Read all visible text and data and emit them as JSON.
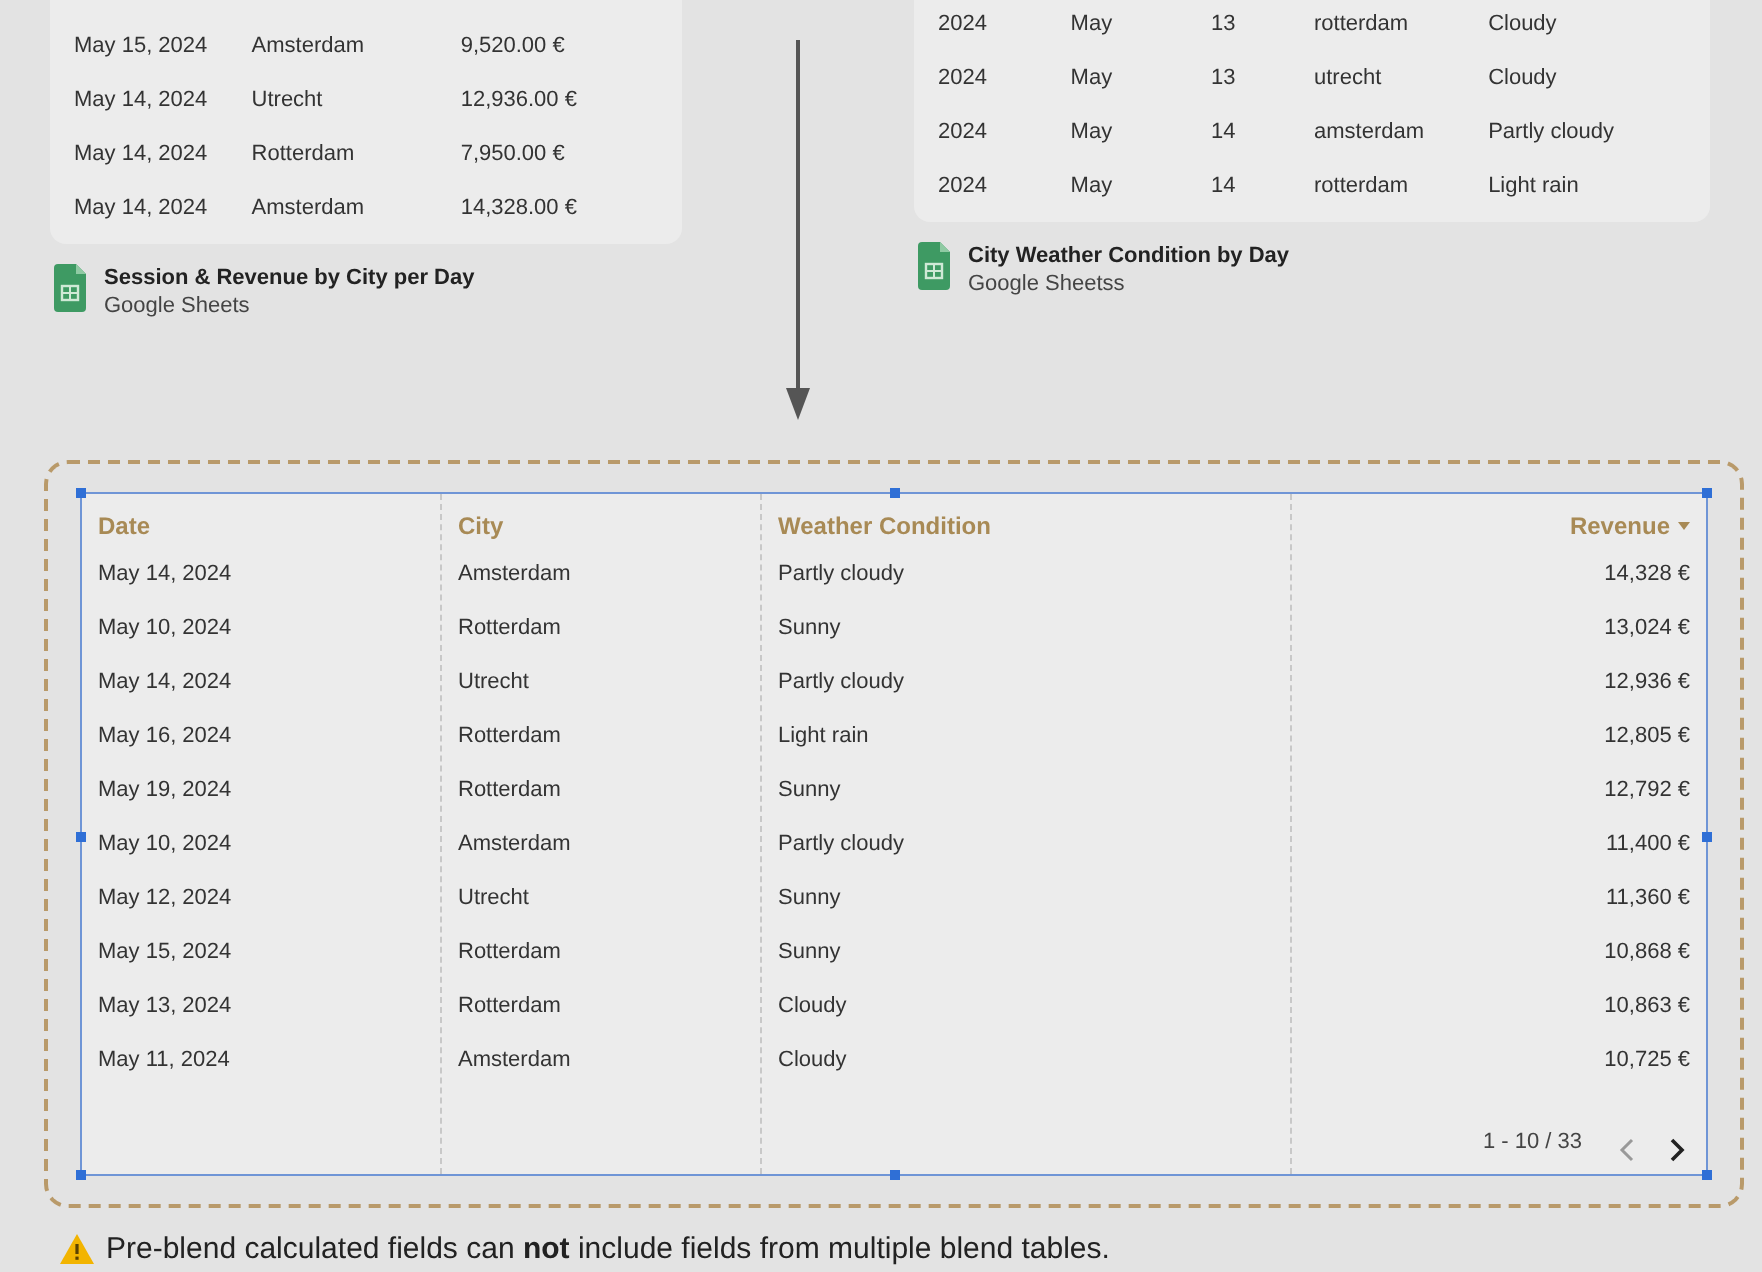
{
  "sources": [
    {
      "rows": [
        [
          "May 15, 2024",
          "Amsterdam",
          "9,520.00 €"
        ],
        [
          "May 14, 2024",
          "Utrecht",
          "12,936.00 €"
        ],
        [
          "May 14, 2024",
          "Rotterdam",
          "7,950.00 €"
        ],
        [
          "May 14, 2024",
          "Amsterdam",
          "14,328.00 €"
        ]
      ],
      "title": "Session & Revenue by City per Day",
      "subtitle": "Google Sheets"
    },
    {
      "rows": [
        [
          "2024",
          "May",
          "13",
          "rotterdam",
          "Cloudy"
        ],
        [
          "2024",
          "May",
          "13",
          "utrecht",
          "Cloudy"
        ],
        [
          "2024",
          "May",
          "14",
          "amsterdam",
          "Partly cloudy"
        ],
        [
          "2024",
          "May",
          "14",
          "rotterdam",
          "Light rain"
        ]
      ],
      "title": "City Weather Condition by Day",
      "subtitle": "Google Sheetss"
    }
  ],
  "table": {
    "columns": [
      {
        "label": "Date",
        "sorted": false
      },
      {
        "label": "City",
        "sorted": false
      },
      {
        "label": "Weather Condition",
        "sorted": false
      },
      {
        "label": "Revenue",
        "sorted": true
      }
    ],
    "rows": [
      [
        "May 14, 2024",
        "Amsterdam",
        "Partly cloudy",
        "14,328 €"
      ],
      [
        "May 10, 2024",
        "Rotterdam",
        "Sunny",
        "13,024 €"
      ],
      [
        "May 14, 2024",
        "Utrecht",
        "Partly cloudy",
        "12,936 €"
      ],
      [
        "May 16, 2024",
        "Rotterdam",
        "Light rain",
        "12,805 €"
      ],
      [
        "May 19, 2024",
        "Rotterdam",
        "Sunny",
        "12,792 €"
      ],
      [
        "May 10, 2024",
        "Amsterdam",
        "Partly cloudy",
        "11,400 €"
      ],
      [
        "May 12, 2024",
        "Utrecht",
        "Sunny",
        "11,360 €"
      ],
      [
        "May 15, 2024",
        "Rotterdam",
        "Sunny",
        "10,868 €"
      ],
      [
        "May 13, 2024",
        "Rotterdam",
        "Cloudy",
        "10,863 €"
      ],
      [
        "May 11, 2024",
        "Amsterdam",
        "Cloudy",
        "10,725 €"
      ]
    ],
    "pagination": "1 - 10 / 33"
  },
  "warning": "Pre-blend calculated fields can **not** include fields from multiple blend tables."
}
